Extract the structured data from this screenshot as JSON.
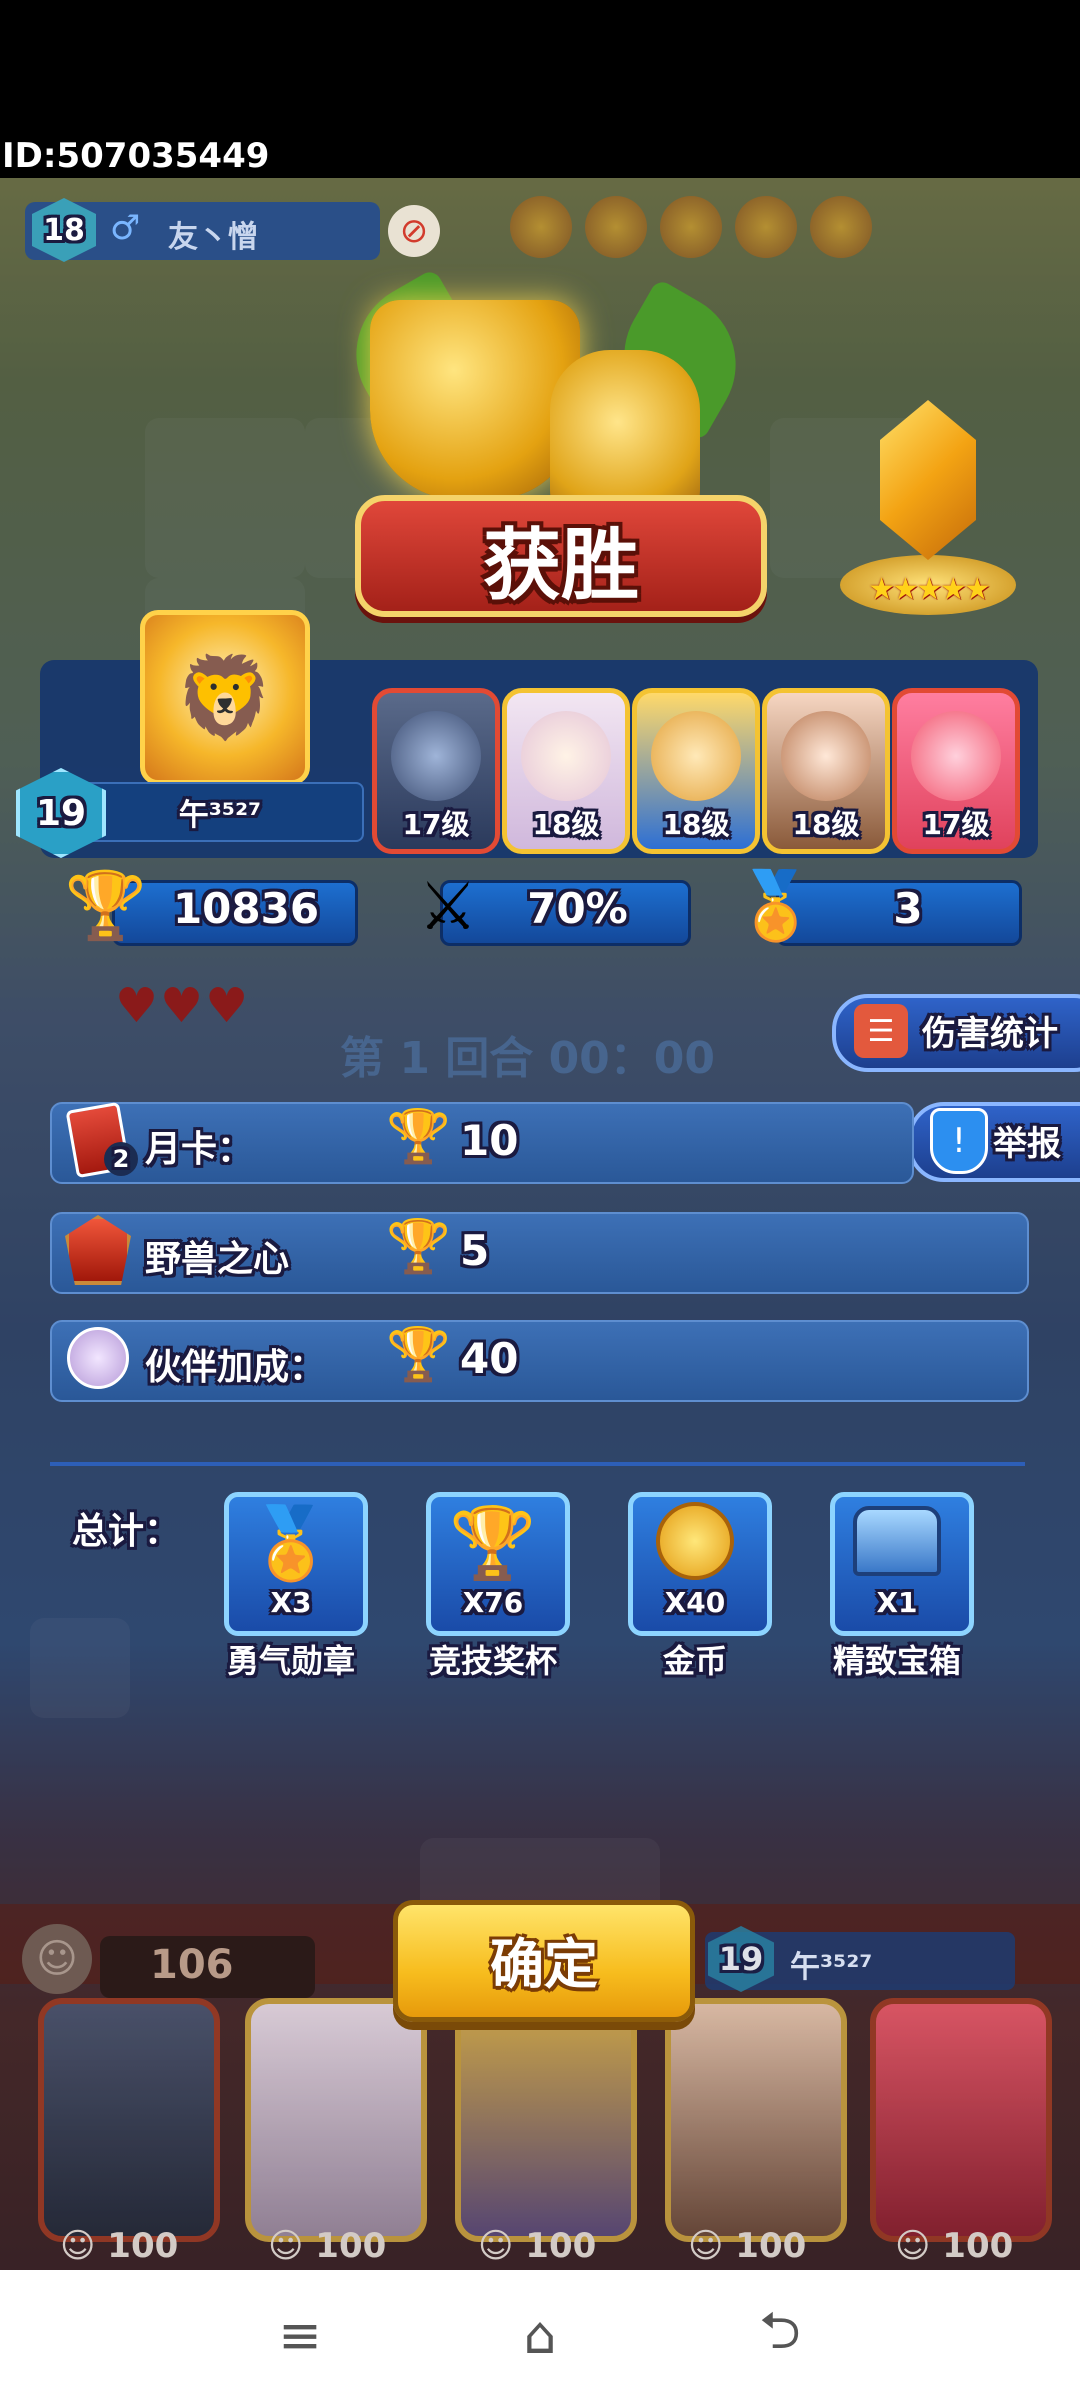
{
  "status": {
    "player_id": "ID:507035449"
  },
  "opponent": {
    "level": "18",
    "name": "友丶憎",
    "gender_icon": "male-icon",
    "block_icon": "block-icon"
  },
  "result": {
    "title": "获胜",
    "rank_stars": 5
  },
  "player": {
    "level": "19",
    "name": "午³⁵²⁷",
    "heroes": [
      {
        "level": "17级",
        "color": "#b83a2a"
      },
      {
        "level": "18级",
        "color": "#d98f22"
      },
      {
        "level": "18级",
        "color": "#d98f22"
      },
      {
        "level": "18级",
        "color": "#d98f22"
      },
      {
        "level": "17级",
        "color": "#b83a2a"
      }
    ]
  },
  "stats": {
    "trophies": "10836",
    "win_rate": "70%",
    "medals": "3"
  },
  "battle": {
    "round_text": "第 1 回合 00：00",
    "damage_stats_label": "伤害统计",
    "report_label": "举报"
  },
  "rewards": {
    "rows": [
      {
        "label": "月卡：",
        "value": "10",
        "badge": "2"
      },
      {
        "label": "野兽之心",
        "value": "5"
      },
      {
        "label": "伙伴加成：",
        "value": "40"
      }
    ],
    "total_label": "总计：",
    "items": [
      {
        "name": "勇气勋章",
        "count": "X3"
      },
      {
        "name": "竞技奖杯",
        "count": "X76"
      },
      {
        "name": "金币",
        "count": "X40"
      },
      {
        "name": "精致宝箱",
        "count": "X1"
      }
    ]
  },
  "bottom": {
    "coins": "106",
    "confirm_label": "确定",
    "level": "19",
    "name": "午³⁵²⁷",
    "card_costs": [
      "100",
      "100",
      "100",
      "100",
      "100"
    ]
  },
  "navigation": {
    "menu_icon": "≡",
    "home_icon": "⌂",
    "back_icon": "⮌"
  }
}
